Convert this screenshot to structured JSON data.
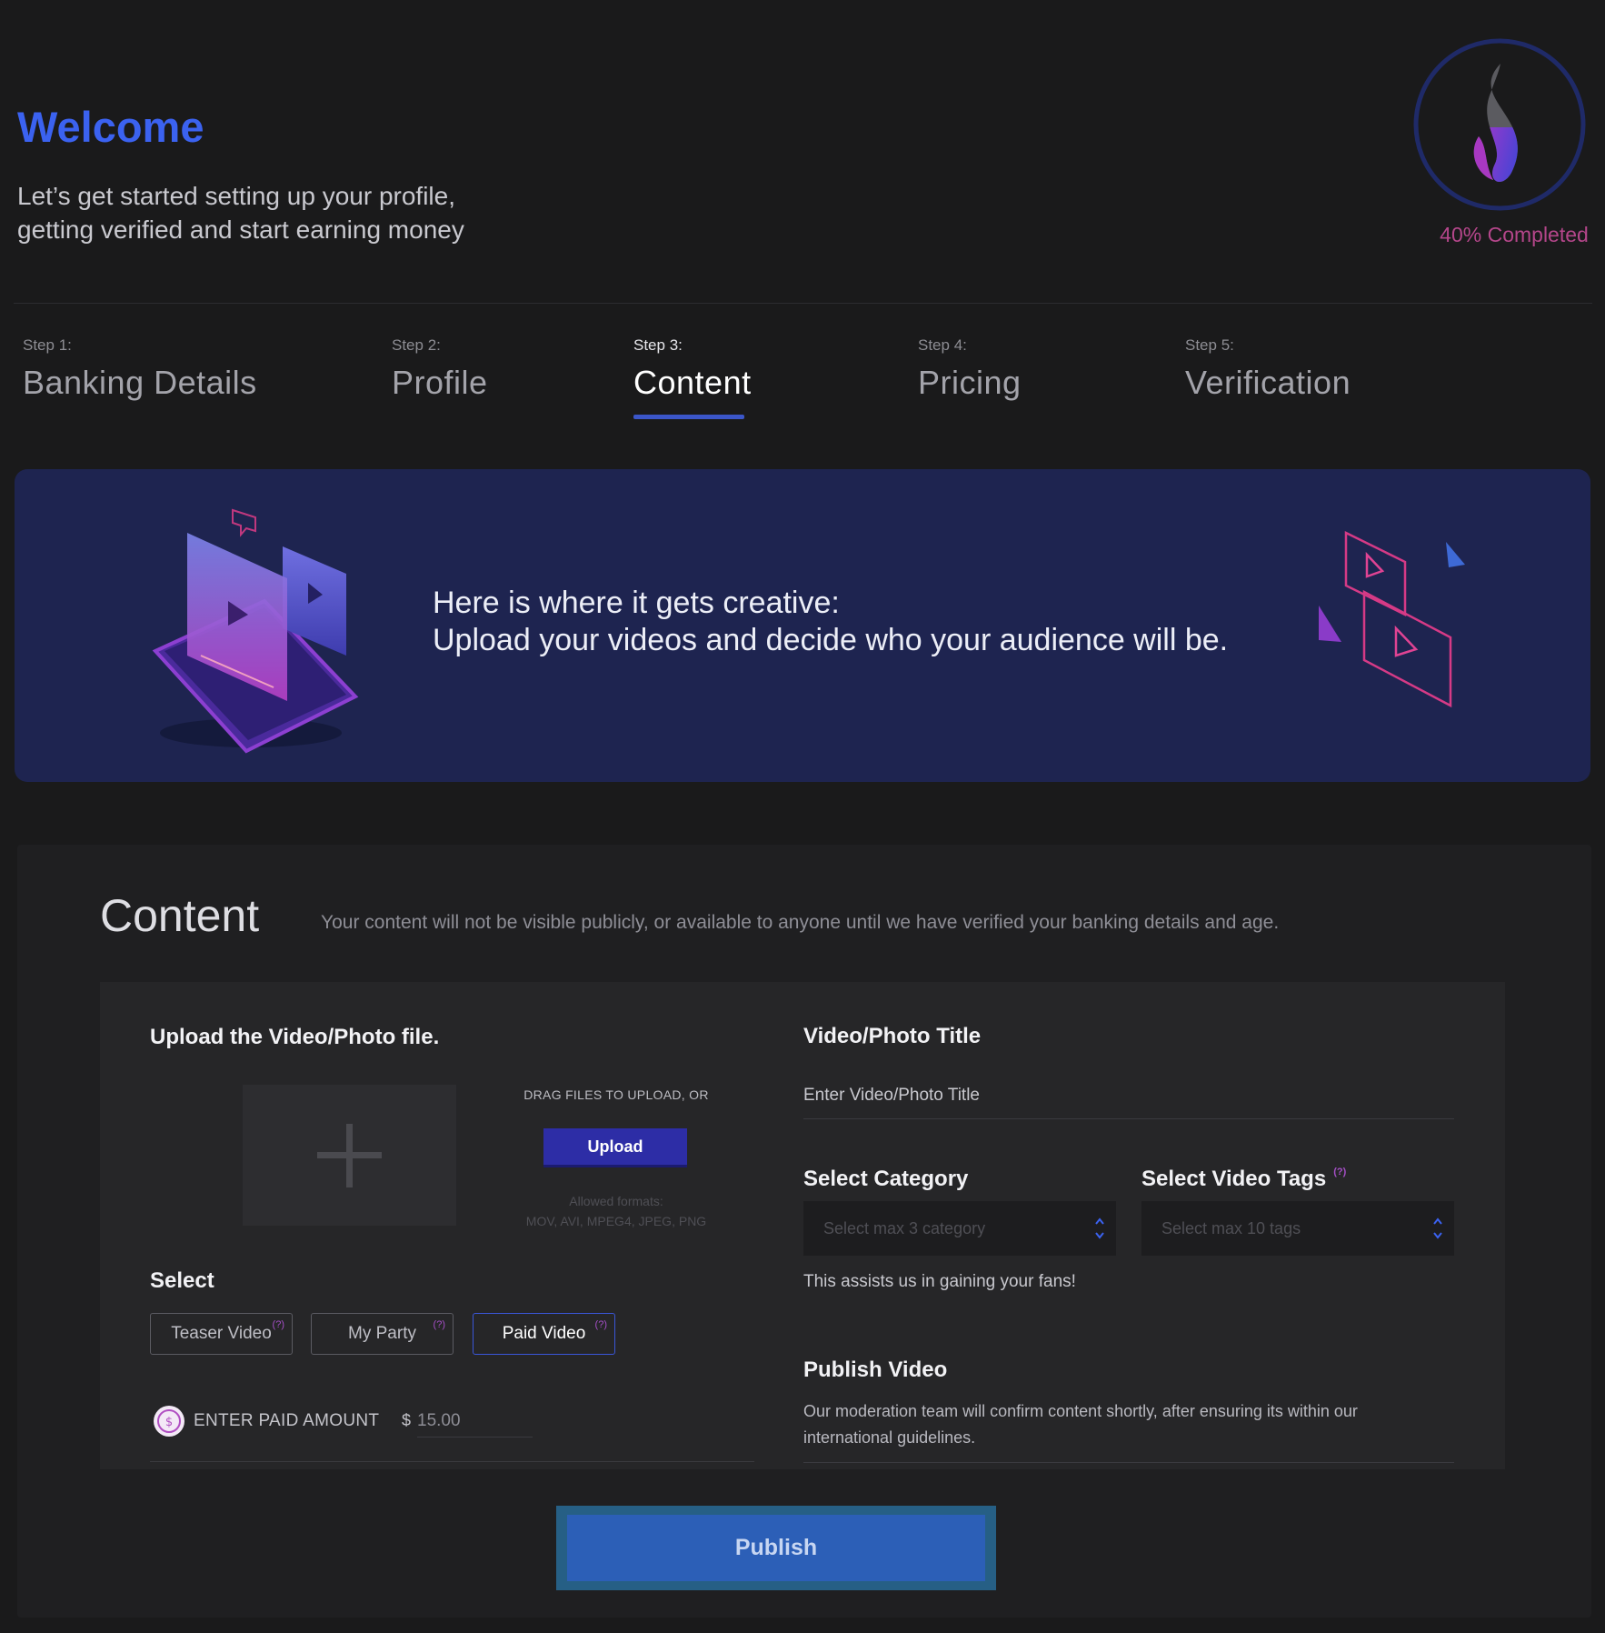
{
  "header": {
    "title": "Welcome",
    "subtitle_line1": "Let’s get started setting up your profile,",
    "subtitle_line2": "getting verified and start earning money",
    "progress_label": "40% Completed",
    "progress_fraction": 0.4
  },
  "steps": [
    {
      "small": "Step 1:",
      "big": "Banking Details",
      "active": false
    },
    {
      "small": "Step 2:",
      "big": "Profile",
      "active": false
    },
    {
      "small": "Step 3:",
      "big": "Content",
      "active": true
    },
    {
      "small": "Step 4:",
      "big": "Pricing",
      "active": false
    },
    {
      "small": "Step 5:",
      "big": "Verification",
      "active": false
    }
  ],
  "banner": {
    "line1": "Here is where it gets creative:",
    "line2": "Upload your videos and decide who your audience will be."
  },
  "content": {
    "title": "Content",
    "note": "Your content will not be visible publicly, or available to anyone until we have verified your banking details and age.",
    "upload": {
      "label": "Upload the Video/Photo file.",
      "drag_text": "DRAG FILES TO UPLOAD, OR",
      "button": "Upload",
      "formats_line1": "Allowed formats:",
      "formats_line2": "MOV, AVI, MPEG4, JPEG, PNG"
    },
    "select": {
      "label": "Select",
      "options": [
        {
          "label": "Teaser Video",
          "hint": "(?)"
        },
        {
          "label": "My Party",
          "hint": "(?)"
        },
        {
          "label": "Paid Video",
          "hint": "(?)"
        }
      ],
      "selected": "Paid Video"
    },
    "paid": {
      "label": "ENTER PAID AMOUNT",
      "currency": "$",
      "value": "15.00"
    },
    "title_field": {
      "label": "Video/Photo Title",
      "placeholder": "Enter Video/Photo Title"
    },
    "category": {
      "label": "Select Category",
      "placeholder": "Select max 3 category"
    },
    "tags": {
      "label": "Select Video Tags",
      "hint": "(?)",
      "placeholder": "Select max 10 tags"
    },
    "assist_text": "This assists us in gaining your fans!",
    "publish_section": {
      "label": "Publish Video",
      "note": "Our moderation team will confirm content shortly, after ensuring its within our international guidelines."
    },
    "publish_button": "Publish"
  },
  "icons": {
    "progress": "flame-icon",
    "upload_zone": "plus-icon",
    "coin": "dollar-coin-icon",
    "select_arrows": "chevron-up-down-icon"
  },
  "colors": {
    "accent": "#3b62f0",
    "progress_text": "#b4468a",
    "banner_bg": "#1e2450",
    "selected_border": "#3a56d8"
  }
}
